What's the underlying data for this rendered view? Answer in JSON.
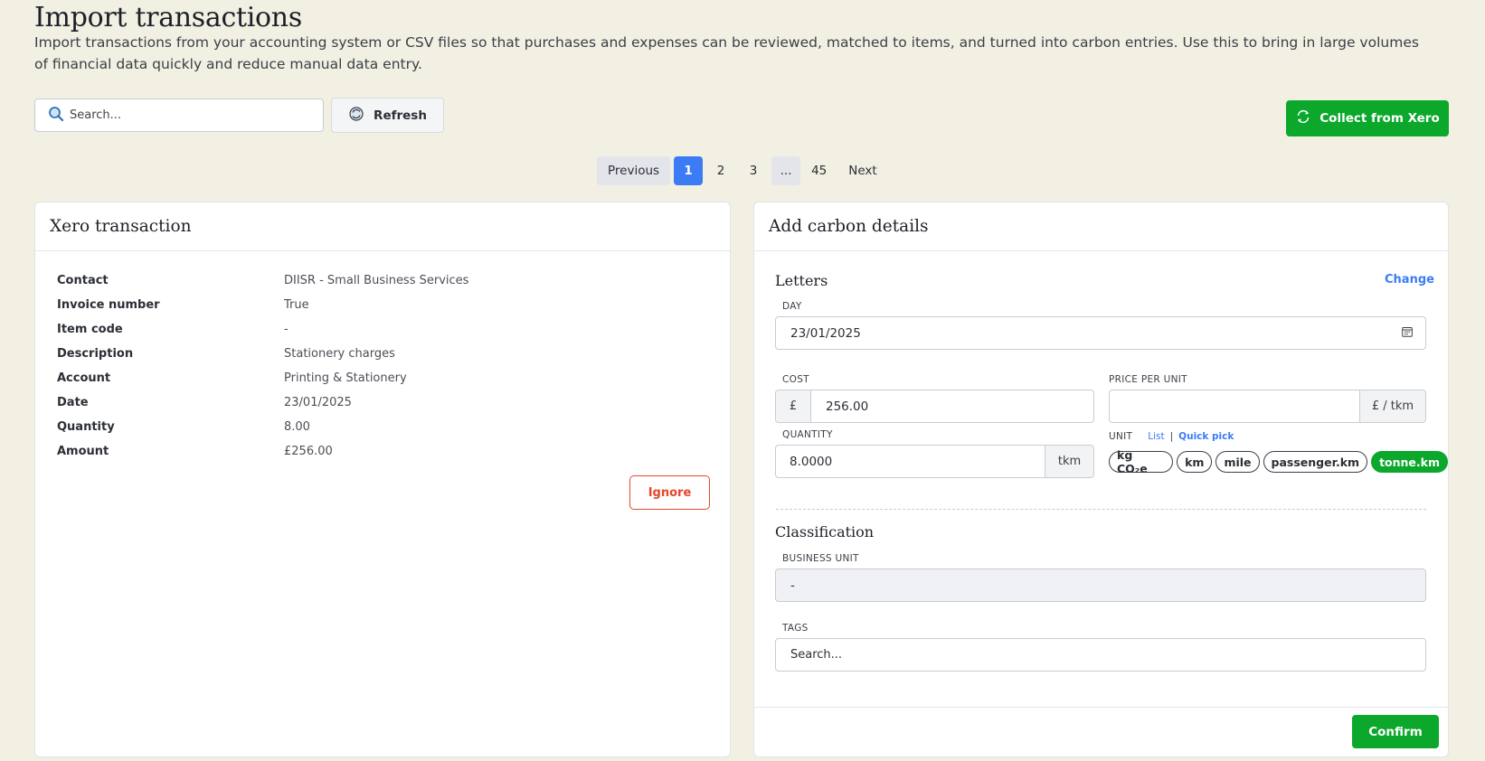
{
  "header": {
    "title": "Import transactions",
    "description": "Import transactions from your accounting system or CSV files so that purchases and expenses can be reviewed, matched to items, and turned into carbon entries. Use this to bring in large volumes of financial data quickly and reduce manual data entry."
  },
  "toolbar": {
    "search_placeholder": "Search...",
    "refresh_label": "Refresh",
    "collect_label": "Collect from Xero"
  },
  "pagination": {
    "previous": "Previous",
    "pages": [
      "1",
      "2",
      "3",
      "...",
      "45"
    ],
    "current": "1",
    "next": "Next"
  },
  "transaction": {
    "title": "Xero transaction",
    "rows": [
      {
        "label": "Contact",
        "value": "DIISR - Small Business Services"
      },
      {
        "label": "Invoice number",
        "value": "True"
      },
      {
        "label": "Item code",
        "value": "-"
      },
      {
        "label": "Description",
        "value": "Stationery charges"
      },
      {
        "label": "Account",
        "value": "Printing & Stationery"
      },
      {
        "label": "Date",
        "value": "23/01/2025"
      },
      {
        "label": "Quantity",
        "value": "8.00"
      },
      {
        "label": "Amount",
        "value": "£256.00"
      }
    ],
    "ignore_label": "Ignore"
  },
  "carbon": {
    "title": "Add carbon details",
    "item_name": "Letters",
    "change_label": "Change",
    "day_label": "DAY",
    "day_value": "23/01/2025",
    "cost_label": "COST",
    "cost_currency": "£",
    "cost_value": "256.00",
    "price_per_unit_label": "PRICE PER UNIT",
    "price_per_unit_value": "",
    "price_per_unit_suffix": "£ / tkm",
    "quantity_label": "QUANTITY",
    "quantity_value": "8.0000",
    "quantity_suffix": "tkm",
    "unit_label": "UNIT",
    "unit_list_link": "List",
    "unit_separator": "|",
    "unit_quick_pick": "Quick pick",
    "units": [
      "kg CO₂e",
      "km",
      "mile",
      "passenger.km",
      "tonne.km"
    ],
    "selected_unit": "tonne.km",
    "classification_title": "Classification",
    "business_unit_label": "BUSINESS UNIT",
    "business_unit_value": "-",
    "tags_label": "TAGS",
    "tags_placeholder": "Search...",
    "confirm_label": "Confirm"
  },
  "colors": {
    "background": "#f2f0e3",
    "primary_green": "#0ba82b",
    "accent_blue": "#3b7bf5",
    "danger_red": "#e5472a"
  }
}
